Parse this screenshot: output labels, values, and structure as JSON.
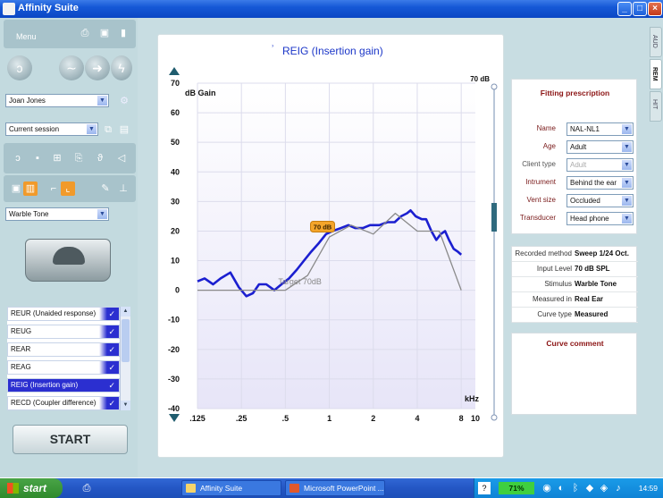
{
  "window": {
    "title": "Affinity Suite"
  },
  "menu": {
    "label": "Menu"
  },
  "client": {
    "name": "Joan Jones"
  },
  "session": {
    "value": "Current session"
  },
  "stimulus_select": {
    "value": "Warble Tone"
  },
  "curves": [
    {
      "label": "REUR (Unaided response)",
      "active": false
    },
    {
      "label": "REUG",
      "active": false
    },
    {
      "label": "REAR",
      "active": false
    },
    {
      "label": "REAG",
      "active": false
    },
    {
      "label": "REIG (Insertion gain)",
      "active": true
    },
    {
      "label": "RECD (Coupler difference)",
      "active": false
    }
  ],
  "check_glyph": "✓",
  "start_label": "START",
  "chart_title": "REIG (Insertion gain)",
  "level_readout": "70 dB",
  "target_label": "Target 70dB",
  "marker_label": "70 dB",
  "chart_data": {
    "type": "line",
    "title": "REIG (Insertion gain)",
    "ylabel": "dB Gain",
    "xlabel": "kHz",
    "ylim": [
      -40,
      70
    ],
    "yticks": [
      70,
      60,
      50,
      40,
      30,
      20,
      10,
      0,
      -10,
      -20,
      -30,
      -40
    ],
    "xticks": [
      {
        "label": ".125",
        "f": 0.125
      },
      {
        "label": ".25",
        "f": 0.25
      },
      {
        "label": ".5",
        "f": 0.5
      },
      {
        "label": "1",
        "f": 1
      },
      {
        "label": "2",
        "f": 2
      },
      {
        "label": "4",
        "f": 4
      },
      {
        "label": "8",
        "f": 8
      },
      {
        "label": "10",
        "f": 10
      }
    ],
    "series": [
      {
        "color": "#1b1fd0",
        "points": [
          [
            0.125,
            3
          ],
          [
            0.14,
            4
          ],
          [
            0.16,
            2
          ],
          [
            0.18,
            4
          ],
          [
            0.21,
            6
          ],
          [
            0.24,
            1
          ],
          [
            0.27,
            -2
          ],
          [
            0.3,
            -1
          ],
          [
            0.33,
            2
          ],
          [
            0.37,
            2
          ],
          [
            0.42,
            0
          ],
          [
            0.47,
            2
          ],
          [
            0.53,
            4
          ],
          [
            0.6,
            7
          ],
          [
            0.67,
            10
          ],
          [
            0.75,
            13
          ],
          [
            0.85,
            16
          ],
          [
            0.95,
            19
          ],
          [
            1.05,
            20
          ],
          [
            1.2,
            21
          ],
          [
            1.35,
            22
          ],
          [
            1.5,
            21
          ],
          [
            1.7,
            21
          ],
          [
            1.9,
            22
          ],
          [
            2.2,
            22
          ],
          [
            2.5,
            23
          ],
          [
            2.8,
            23
          ],
          [
            3.1,
            25
          ],
          [
            3.4,
            26
          ],
          [
            3.6,
            27
          ],
          [
            3.9,
            25
          ],
          [
            4.3,
            24
          ],
          [
            4.6,
            24
          ],
          [
            5.0,
            20
          ],
          [
            5.4,
            17
          ],
          [
            5.8,
            19
          ],
          [
            6.2,
            20
          ],
          [
            6.6,
            17
          ],
          [
            7.1,
            14
          ],
          [
            7.6,
            13
          ],
          [
            8.0,
            12
          ]
        ]
      },
      {
        "color": "#8a8a8a",
        "points": [
          [
            0.125,
            0
          ],
          [
            0.5,
            0
          ],
          [
            0.71,
            5
          ],
          [
            1,
            18
          ],
          [
            1.41,
            22
          ],
          [
            2,
            19
          ],
          [
            2.83,
            26
          ],
          [
            4,
            20
          ],
          [
            5.66,
            20
          ],
          [
            8,
            0
          ]
        ]
      }
    ]
  },
  "fitting": {
    "title": "Fitting prescription",
    "rows": [
      {
        "label": "Name",
        "value": "NAL-NL1",
        "enabled": true
      },
      {
        "label": "Age",
        "value": "Adult",
        "enabled": true
      },
      {
        "label": "Client type",
        "value": "Adult",
        "enabled": false
      },
      {
        "label": "Intrument",
        "value": "Behind the ear",
        "enabled": true
      },
      {
        "label": "Vent size",
        "value": "Occluded",
        "enabled": true
      },
      {
        "label": "Transducer",
        "value": "Head phone",
        "enabled": true
      }
    ]
  },
  "info": [
    {
      "k": "Recorded method",
      "v": "Sweep 1/24 Oct."
    },
    {
      "k": "Input Level",
      "v": "70 dB SPL"
    },
    {
      "k": "Stimulus",
      "v": "Warble Tone"
    },
    {
      "k": "Measured in",
      "v": "Real Ear"
    },
    {
      "k": "Curve type",
      "v": "Measured"
    }
  ],
  "comment_title": "Curve comment",
  "tabs": [
    "AUD",
    "REM",
    "HIT"
  ],
  "taskbar": {
    "start": "start",
    "items": [
      "Affinity Suite",
      "Microsoft PowerPoint ..."
    ],
    "battery": "71%",
    "clock": "14:59"
  }
}
